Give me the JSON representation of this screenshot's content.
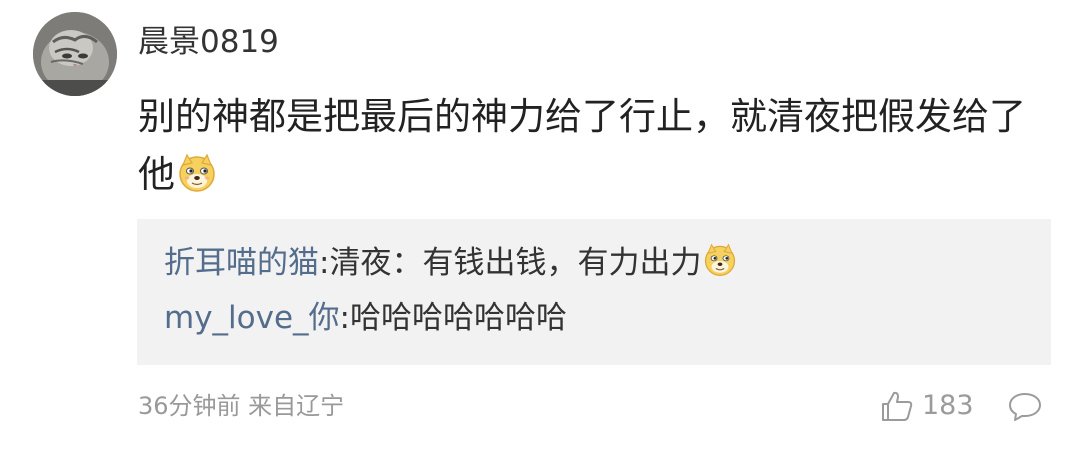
{
  "comment": {
    "username": "晨景0819",
    "text": "别的神都是把最后的神力给了行止，就清夜把假发给了他",
    "text_emoji": "doge-emoji",
    "replies": [
      {
        "user": "折耳喵的猫",
        "text": ":清夜：有钱出钱，有力出力",
        "emoji": "doge-emoji"
      },
      {
        "user": "my_love_你",
        "text": ":哈哈哈哈哈哈哈"
      }
    ],
    "meta": "36分钟前 来自辽宁",
    "likes": "183",
    "icons": {
      "like": "thumb-up-icon",
      "reply": "comment-icon"
    },
    "colors": {
      "reply_username": "#546d8c",
      "reply_background": "#f2f2f2",
      "meta_text": "#999999"
    }
  }
}
